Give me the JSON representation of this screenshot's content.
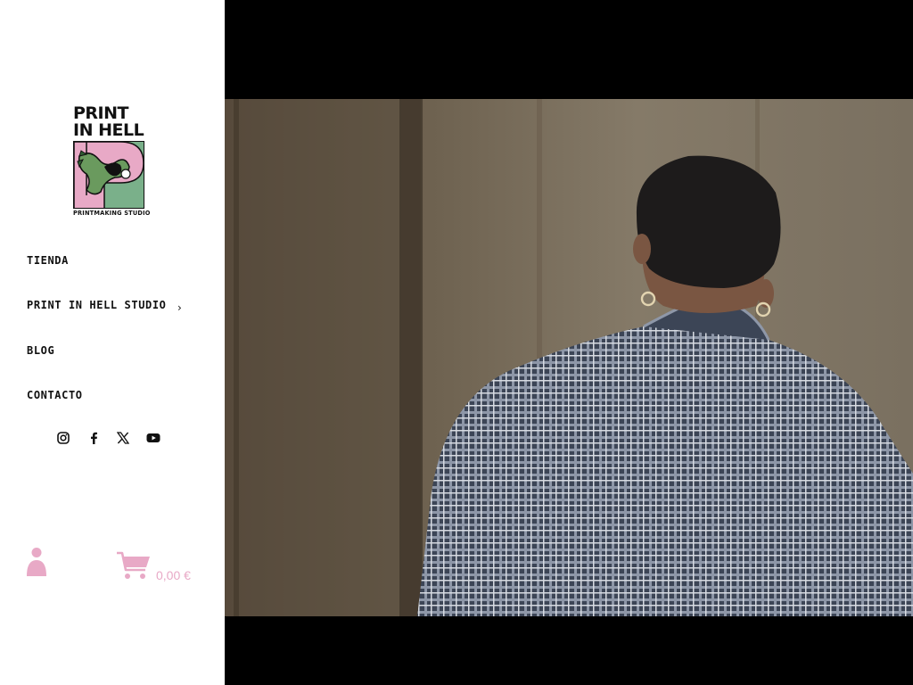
{
  "brand": {
    "logo_line1": "PRINT",
    "logo_line2": "IN HELL",
    "tagline": "PRINTMAKING STUDIO"
  },
  "nav": {
    "items": [
      {
        "label": "TIENDA"
      },
      {
        "label": "PRINT IN HELL STUDIO",
        "has_submenu": true
      },
      {
        "label": "BLOG"
      },
      {
        "label": "CONTACTO"
      }
    ],
    "submenu_indicator": "›"
  },
  "social": [
    "instagram-icon",
    "facebook-icon",
    "x-twitter-icon",
    "youtube-icon"
  ],
  "cart": {
    "total": "0,00 €",
    "accent_color": "#e8a9c6"
  },
  "colors": {
    "text": "#111111",
    "accent_pink": "#e8a9c6",
    "logo_green": "#7ab08a",
    "logo_pink": "#e8a9c6"
  },
  "video": {
    "content": "film-still-man-plaid-shirt"
  }
}
